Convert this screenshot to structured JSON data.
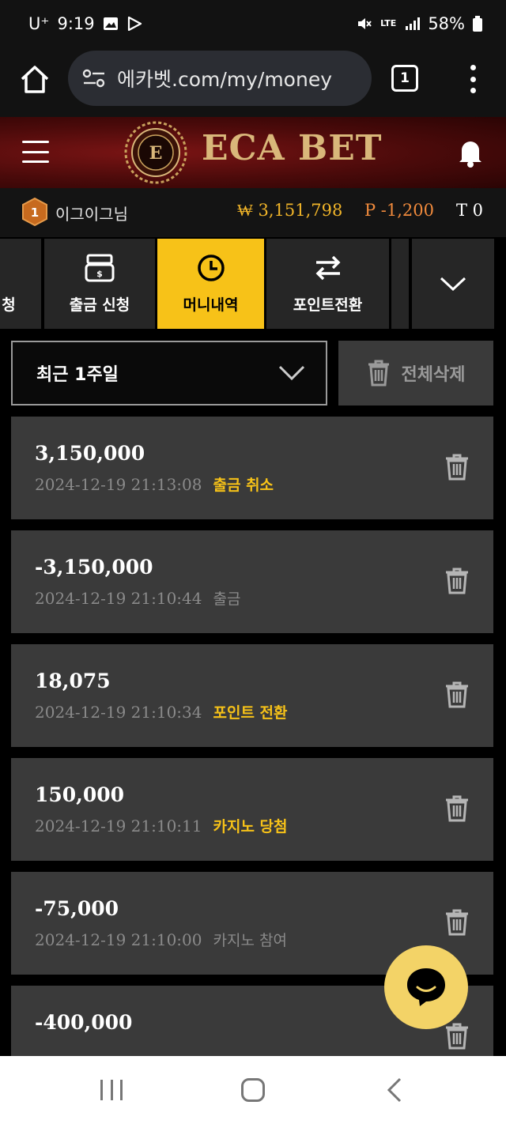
{
  "status_bar": {
    "carrier": "U⁺",
    "time": "9:19",
    "network": "LTE",
    "battery": "58%"
  },
  "browser": {
    "url": "에카벳.com/my/money",
    "tab_count": "1"
  },
  "header": {
    "logo_text": "ECA BET",
    "emblem_letter": "E"
  },
  "user": {
    "level": "1",
    "name": "이그이그님",
    "money": "₩ 3,151,798",
    "points": "P -1,200",
    "tickets": "T 0"
  },
  "menu_tabs": [
    {
      "label": "청"
    },
    {
      "label": "출금 신청"
    },
    {
      "label": "머니내역",
      "active": true
    },
    {
      "label": "포인트전환"
    }
  ],
  "filter": {
    "selected": "최근 1주일",
    "delete_all_label": "전체삭제"
  },
  "history": [
    {
      "amount": "3,150,000",
      "datetime": "2024-12-19 21:13:08",
      "type": "출금 취소",
      "highlight": true
    },
    {
      "amount": "-3,150,000",
      "datetime": "2024-12-19 21:10:44",
      "type": "출금",
      "highlight": false
    },
    {
      "amount": "18,075",
      "datetime": "2024-12-19 21:10:34",
      "type": "포인트 전환",
      "highlight": true
    },
    {
      "amount": "150,000",
      "datetime": "2024-12-19 21:10:11",
      "type": "카지노 당첨",
      "highlight": true
    },
    {
      "amount": "-75,000",
      "datetime": "2024-12-19 21:10:00",
      "type": "카지노 참여",
      "highlight": false
    },
    {
      "amount": "-400,000",
      "datetime": "",
      "type": "",
      "highlight": false
    }
  ],
  "colors": {
    "accent": "#f7c218",
    "money": "#f0b429",
    "points": "#f08a3c",
    "header_red": "#6a1010",
    "card_bg": "#3a3a3a"
  }
}
